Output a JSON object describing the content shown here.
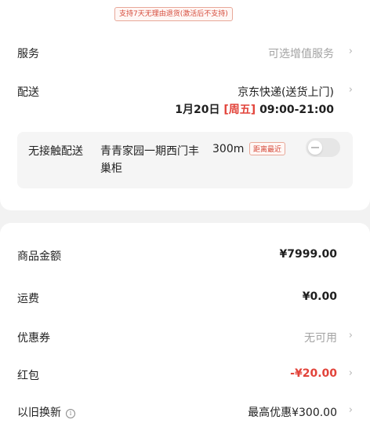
{
  "top_notice": "支持7天无理由退货(激活后不支持)",
  "service": {
    "label": "服务",
    "value": "可选增值服务"
  },
  "delivery": {
    "label": "配送",
    "carrier": "京东快递(送货上门)",
    "date": "1月20日",
    "weekday": "[周五]",
    "time": "09:00-21:00"
  },
  "contactless": {
    "label": "无接触配送",
    "location": "青青家园一期西门丰巢柜",
    "distance": "300m",
    "nearest_tag": "距离最近"
  },
  "summary": {
    "goods": {
      "label": "商品金额",
      "value": "¥7999.00"
    },
    "shipping": {
      "label": "运费",
      "value": "¥0.00"
    },
    "coupon": {
      "label": "优惠券",
      "value": "无可用"
    },
    "red_packet": {
      "label": "红包",
      "value": "-¥20.00"
    },
    "trade_in": {
      "label": "以旧换新",
      "info_icon": "ⓘ",
      "value": "最高优惠¥300.00"
    }
  },
  "icons": {
    "chevron": "›"
  },
  "colors": {
    "accent": "#e2433a",
    "muted": "#a3a3a3"
  }
}
